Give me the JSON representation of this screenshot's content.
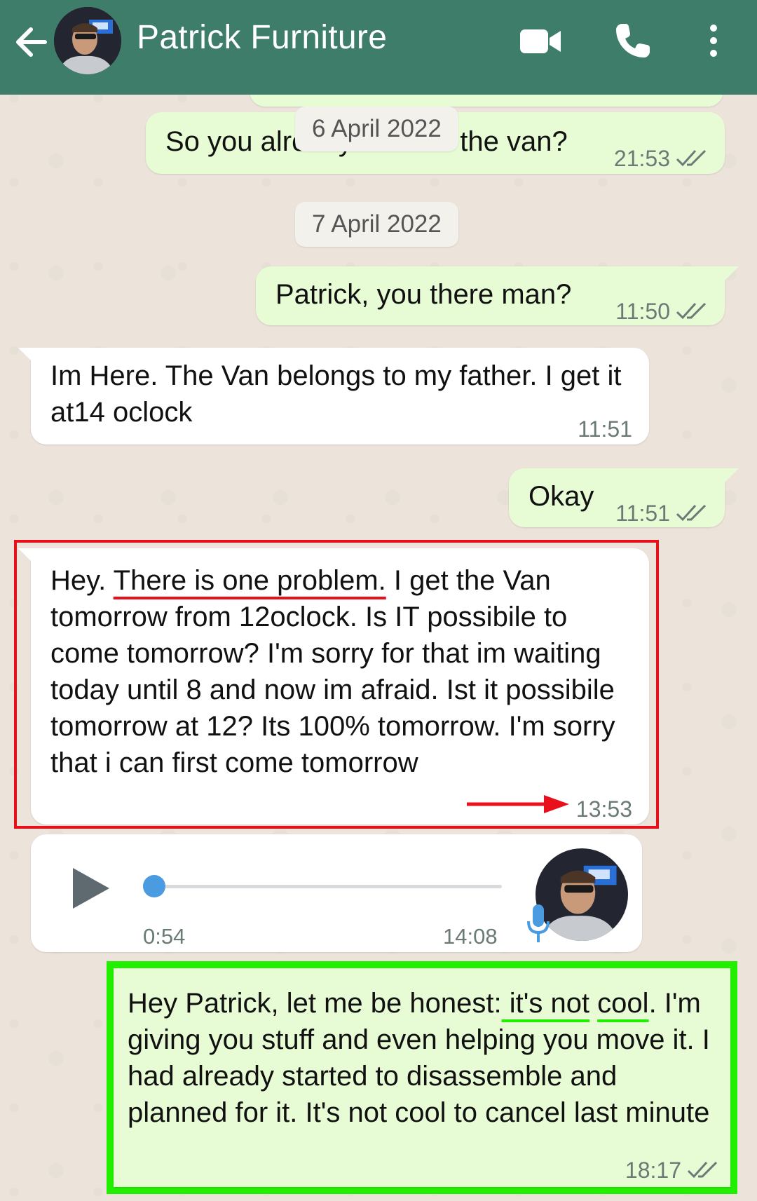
{
  "header": {
    "title": "Patrick Furniture"
  },
  "dates": {
    "date1": "6 April 2022",
    "date2": "7 April 2022"
  },
  "messages": [
    {
      "direction": "out",
      "text": "So you already booked the van?",
      "time": "21:53"
    },
    {
      "direction": "out",
      "text": "Patrick, you there man?",
      "time": "11:50"
    },
    {
      "direction": "in",
      "text": "Im Here. The Van belongs to my father. I get it at14 oclock",
      "time": "11:51"
    },
    {
      "direction": "out",
      "text": "Okay",
      "time": "11:51"
    },
    {
      "direction": "in",
      "line1_pre": "Hey. ",
      "line1_hl": "There is one problem.",
      "line1_post": " I get the Van",
      "text_rest": "tomorrow from 12oclock. Is IT possibile to come tomorrow? I'm sorry for that im waiting today until 8 and now im afraid. Ist it possibile tomorrow at 12? Its 100% tomorrow. I'm sorry that i can first come tomorrow",
      "time": "13:53"
    },
    {
      "direction": "in",
      "type": "voice",
      "duration": "0:54",
      "time": "14:08"
    },
    {
      "direction": "out",
      "pre": "Hey Patrick, let me be honest:",
      "hl1": " it's not",
      "hl2": "cool",
      "post": ". I'm giving you stuff and even helping you move it. I had already started to disassemble and planned for it. It's not cool to cancel last minute",
      "time": "18:17"
    }
  ],
  "colors": {
    "header": "#3f7d6b",
    "outgoing_bubble": "#e7fbd4",
    "incoming_bubble": "#ffffff",
    "red_annotation": "#e8101a",
    "green_annotation": "#22ee00",
    "voice_dot": "#4a9be0"
  }
}
